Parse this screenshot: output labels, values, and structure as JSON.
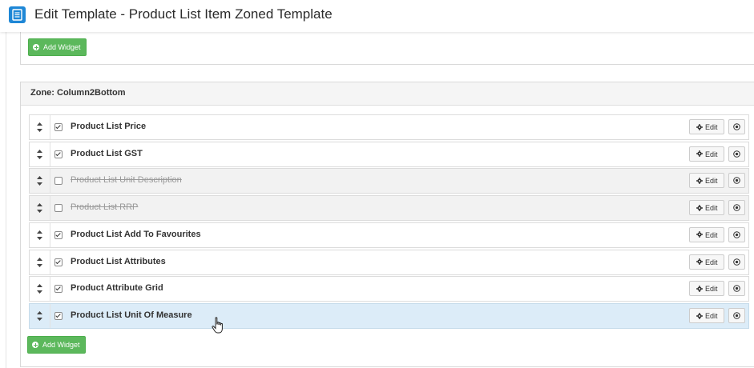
{
  "header": {
    "title": "Edit Template - Product List Item Zoned Template",
    "icon": "template-icon"
  },
  "top_panel": {
    "add_widget_label": "Add Widget"
  },
  "zone": {
    "title": "Zone: Column2Bottom",
    "widgets": [
      {
        "label": "Product List Price",
        "checked": true,
        "enabled": true
      },
      {
        "label": "Product List GST",
        "checked": true,
        "enabled": true
      },
      {
        "label": "Product List Unit Description",
        "checked": false,
        "enabled": false
      },
      {
        "label": "Product List RRP",
        "checked": false,
        "enabled": false
      },
      {
        "label": "Product List Add To Favourites",
        "checked": true,
        "enabled": true
      },
      {
        "label": "Product List Attributes",
        "checked": true,
        "enabled": true
      },
      {
        "label": "Product Attribute Grid",
        "checked": true,
        "enabled": true
      },
      {
        "label": "Product List Unit Of Measure",
        "checked": true,
        "enabled": true,
        "hovered": true
      }
    ],
    "edit_label": "Edit",
    "add_widget_label": "Add Widget"
  },
  "colors": {
    "accent": "#1e87d6",
    "success": "#5cb85c",
    "hover_row": "#dcecf8"
  }
}
